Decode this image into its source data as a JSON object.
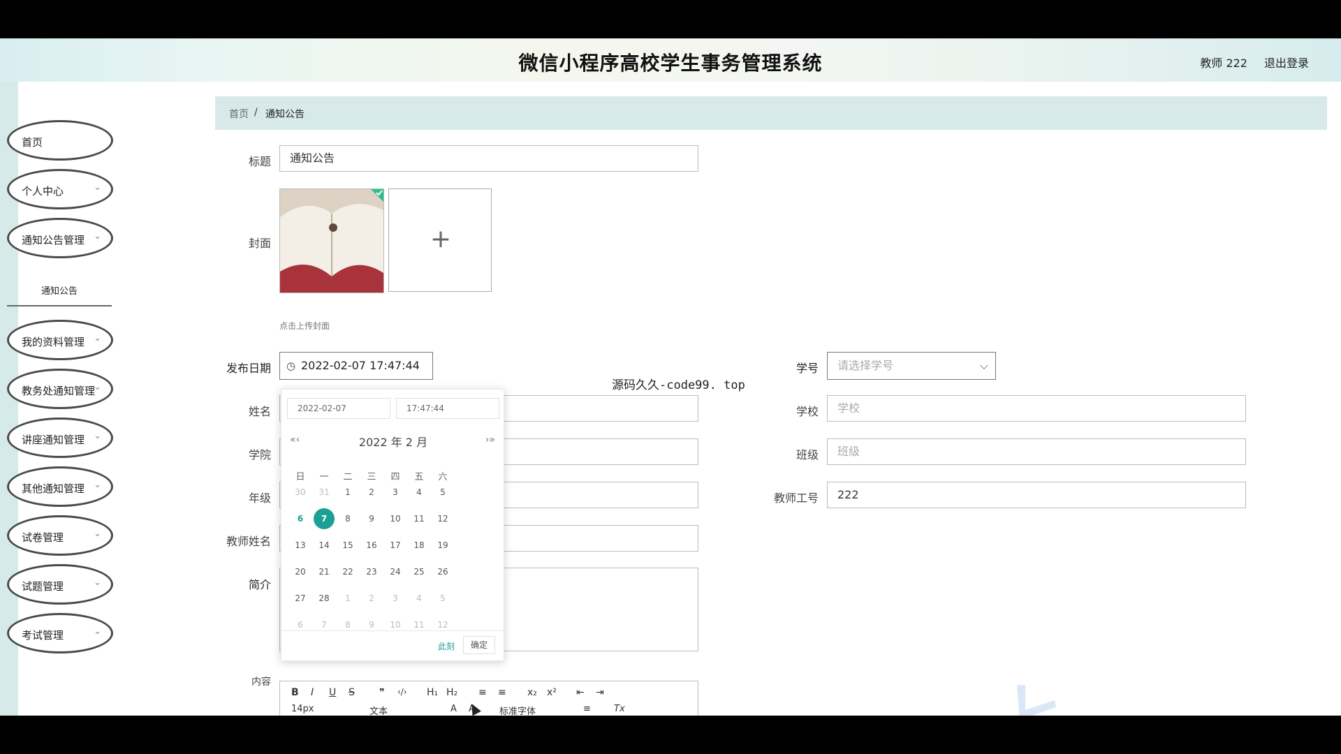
{
  "header": {
    "title": "微信小程序高校学生事务管理系统",
    "user": "教师 222",
    "logout": "退出登录"
  },
  "sidebar": {
    "items": [
      {
        "label": "首页",
        "chevron": ""
      },
      {
        "label": "个人中心",
        "chevron": "⌄"
      },
      {
        "label": "通知公告管理",
        "chevron": "⌄"
      },
      {
        "label": "我的资料管理",
        "chevron": "⌄"
      },
      {
        "label": "教务处通知管理",
        "chevron": "⌄"
      },
      {
        "label": "讲座通知管理",
        "chevron": "⌄"
      },
      {
        "label": "其他通知管理",
        "chevron": "⌄"
      },
      {
        "label": "试卷管理",
        "chevron": "⌄"
      },
      {
        "label": "试题管理",
        "chevron": "⌄"
      },
      {
        "label": "考试管理",
        "chevron": "⌄"
      }
    ],
    "submenu": "通知公告"
  },
  "breadcrumb": {
    "home": "首页",
    "sep": "/",
    "current": "通知公告"
  },
  "form": {
    "title_label": "标题",
    "title_value": "通知公告",
    "cover_label": "封面",
    "upload_hint": "点击上传封面",
    "upload_plus": "+",
    "date_label": "发布日期",
    "date_value": "2022-02-07 17:47:44",
    "student_no_label": "学号",
    "student_no_placeholder": "请选择学号",
    "name_label": "姓名",
    "school_label": "学校",
    "school_placeholder": "学校",
    "college_label": "学院",
    "class_label": "班级",
    "class_placeholder": "班级",
    "grade_label": "年级",
    "teacher_no_label": "教师工号",
    "teacher_no_value": "222",
    "teacher_name_label": "教师姓名",
    "intro_label": "简介",
    "content_label": "内容"
  },
  "overlay_text": "源码久久-code99. top",
  "picker": {
    "date_input": "2022-02-07",
    "time_input": "17:47:44",
    "month_title": "2022 年  2 月",
    "prev": "«‹",
    "next": "›»",
    "weekdays": [
      "日",
      "一",
      "二",
      "三",
      "四",
      "五",
      "六"
    ],
    "days": [
      [
        "30",
        "31",
        "1",
        "2",
        "3",
        "4",
        "5"
      ],
      [
        "6",
        "7",
        "8",
        "9",
        "10",
        "11",
        "12"
      ],
      [
        "13",
        "14",
        "15",
        "16",
        "17",
        "18",
        "19"
      ],
      [
        "20",
        "21",
        "22",
        "23",
        "24",
        "25",
        "26"
      ],
      [
        "27",
        "28",
        "1",
        "2",
        "3",
        "4",
        "5"
      ],
      [
        "6",
        "7",
        "8",
        "9",
        "10",
        "11",
        "12"
      ]
    ],
    "now_label": "此刻",
    "confirm_label": "确定"
  },
  "toolbar": {
    "row1": [
      "B",
      "I",
      "U",
      "S",
      "❞",
      "‹/›",
      "H₁",
      "H₂",
      "≡",
      "≡",
      "x₂",
      "x²",
      "⇤",
      "⇥"
    ],
    "font_size": "14px",
    "paragraph": "文本",
    "font_family": "标准字体",
    "row2_icons": [
      "A",
      "A",
      "≡",
      "Tx"
    ]
  },
  "colors": {
    "accent": "#1aa094",
    "breadcrumb_bg": "#d8e9ea"
  }
}
